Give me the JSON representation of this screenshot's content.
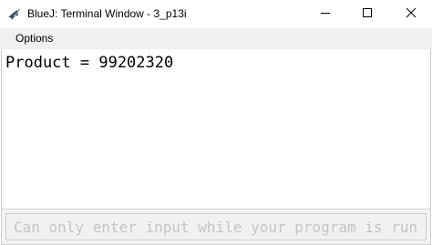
{
  "window": {
    "title": "BlueJ: Terminal Window - 3_p13i"
  },
  "menu": {
    "items": [
      {
        "label": "Options"
      }
    ]
  },
  "terminal": {
    "output_lines": [
      "Product = 99202320"
    ]
  },
  "input": {
    "placeholder": "Can only enter input while your program is running",
    "value": ""
  },
  "icons": {
    "app": "bluej-bird-icon",
    "minimize": "minimize-icon",
    "maximize": "maximize-icon",
    "close": "close-icon"
  },
  "colors": {
    "menubar_bg": "#f0f0f0",
    "input_text": "#c4c4c4"
  }
}
